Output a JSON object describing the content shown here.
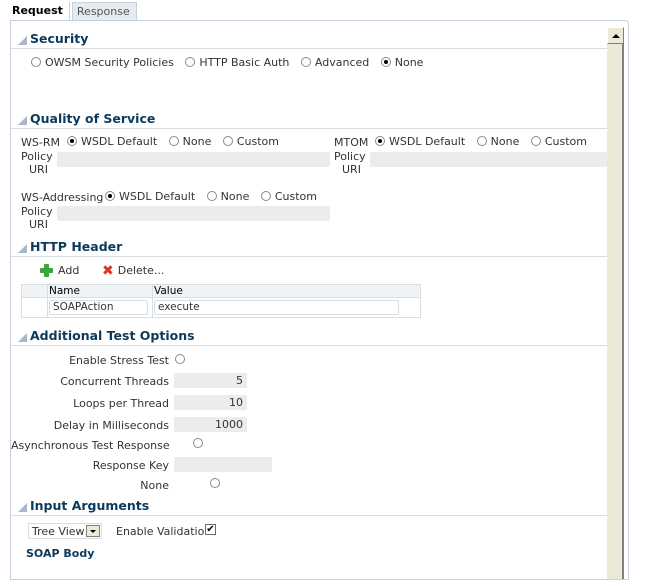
{
  "tabs": [
    {
      "label": "Request",
      "active": true
    },
    {
      "label": "Response",
      "active": false
    }
  ],
  "security": {
    "title": "Security",
    "options": [
      {
        "label": "OWSM Security Policies",
        "checked": false
      },
      {
        "label": "HTTP Basic Auth",
        "checked": false
      },
      {
        "label": "Advanced",
        "checked": false
      },
      {
        "label": "None",
        "checked": true
      }
    ]
  },
  "qos": {
    "title": "Quality of Service",
    "wsrm": {
      "label": "WS-RM",
      "options": [
        {
          "label": "WSDL Default",
          "checked": true
        },
        {
          "label": "None",
          "checked": false
        },
        {
          "label": "Custom",
          "checked": false
        }
      ],
      "policy_label_1": "Policy",
      "policy_label_2": "URI",
      "policy_value": ""
    },
    "mtom": {
      "label": "MTOM",
      "options": [
        {
          "label": "WSDL Default",
          "checked": true
        },
        {
          "label": "None",
          "checked": false
        },
        {
          "label": "Custom",
          "checked": false
        }
      ],
      "policy_label_1": "Policy",
      "policy_label_2": "URI",
      "policy_value": ""
    },
    "wsaddressing": {
      "label": "WS-Addressing",
      "options": [
        {
          "label": "WSDL Default",
          "checked": true
        },
        {
          "label": "None",
          "checked": false
        },
        {
          "label": "Custom",
          "checked": false
        }
      ],
      "policy_label_1": "Policy",
      "policy_label_2": "URI",
      "policy_value": ""
    }
  },
  "http_header": {
    "title": "HTTP Header",
    "add_label": "Add",
    "delete_label": "Delete...",
    "columns": [
      "Name",
      "Value"
    ],
    "rows": [
      {
        "name": "SOAPAction",
        "value": "execute"
      }
    ]
  },
  "test_options": {
    "title": "Additional Test Options",
    "enable_stress_label": "Enable Stress Test",
    "concurrent_threads_label": "Concurrent Threads",
    "concurrent_threads_value": "5",
    "loops_label": "Loops per Thread",
    "loops_value": "10",
    "delay_label": "Delay in Milliseconds",
    "delay_value": "1000",
    "async_label": "Asynchronous Test Response",
    "response_key_label": "Response Key",
    "response_key_value": "",
    "none_label": "None"
  },
  "input_args": {
    "title": "Input Arguments",
    "view_select": "Tree View",
    "enable_validation_label": "Enable Validation",
    "enable_validation_checked": true,
    "soap_body_label": "SOAP Body"
  }
}
